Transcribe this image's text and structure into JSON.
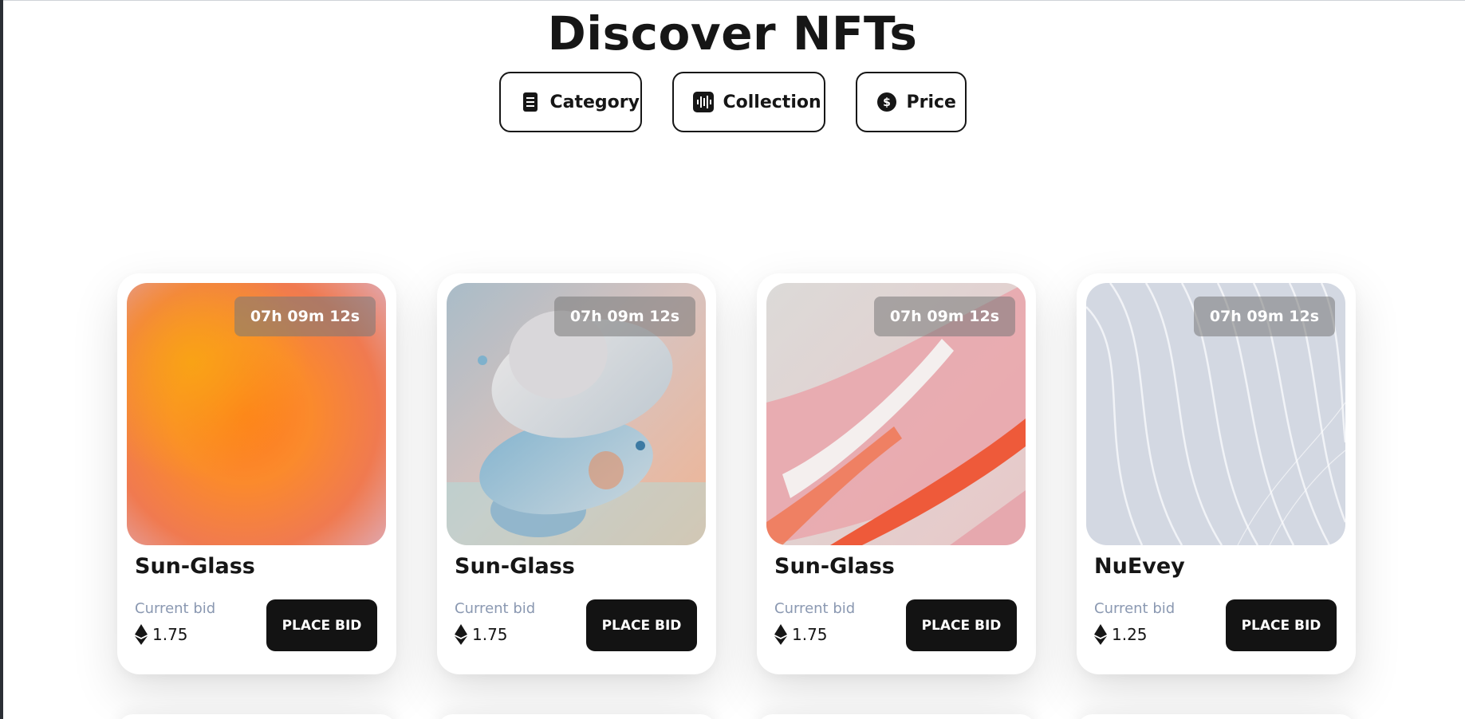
{
  "page": {
    "title": "Discover NFTs"
  },
  "filters": [
    {
      "label": "Category",
      "icon": "document-icon"
    },
    {
      "label": "Collection",
      "icon": "audio-wave-icon"
    },
    {
      "label": "Price",
      "icon": "dollar-coin-icon"
    }
  ],
  "cards": [
    {
      "timer": "07h 09m 12s",
      "name": "Sun-Glass",
      "bid_label": "Current bid",
      "bid": "1.75",
      "button": "PLACE BID",
      "image": "orange-gradient"
    },
    {
      "timer": "07h 09m 12s",
      "name": "Sun-Glass",
      "bid_label": "Current bid",
      "bid": "1.75",
      "button": "PLACE BID",
      "image": "abstract-discs"
    },
    {
      "timer": "07h 09m 12s",
      "name": "Sun-Glass",
      "bid_label": "Current bid",
      "bid": "1.75",
      "button": "PLACE BID",
      "image": "pink-paint-strokes"
    },
    {
      "timer": "07h 09m 12s",
      "name": "NuEvey",
      "bid_label": "Current bid",
      "bid": "1.25",
      "button": "PLACE BID",
      "image": "white-waves"
    }
  ],
  "colors": {
    "text": "#161616",
    "muted": "#8a98b1",
    "button_bg": "#131313",
    "timer_bg": "rgba(120,120,120,0.55)"
  }
}
